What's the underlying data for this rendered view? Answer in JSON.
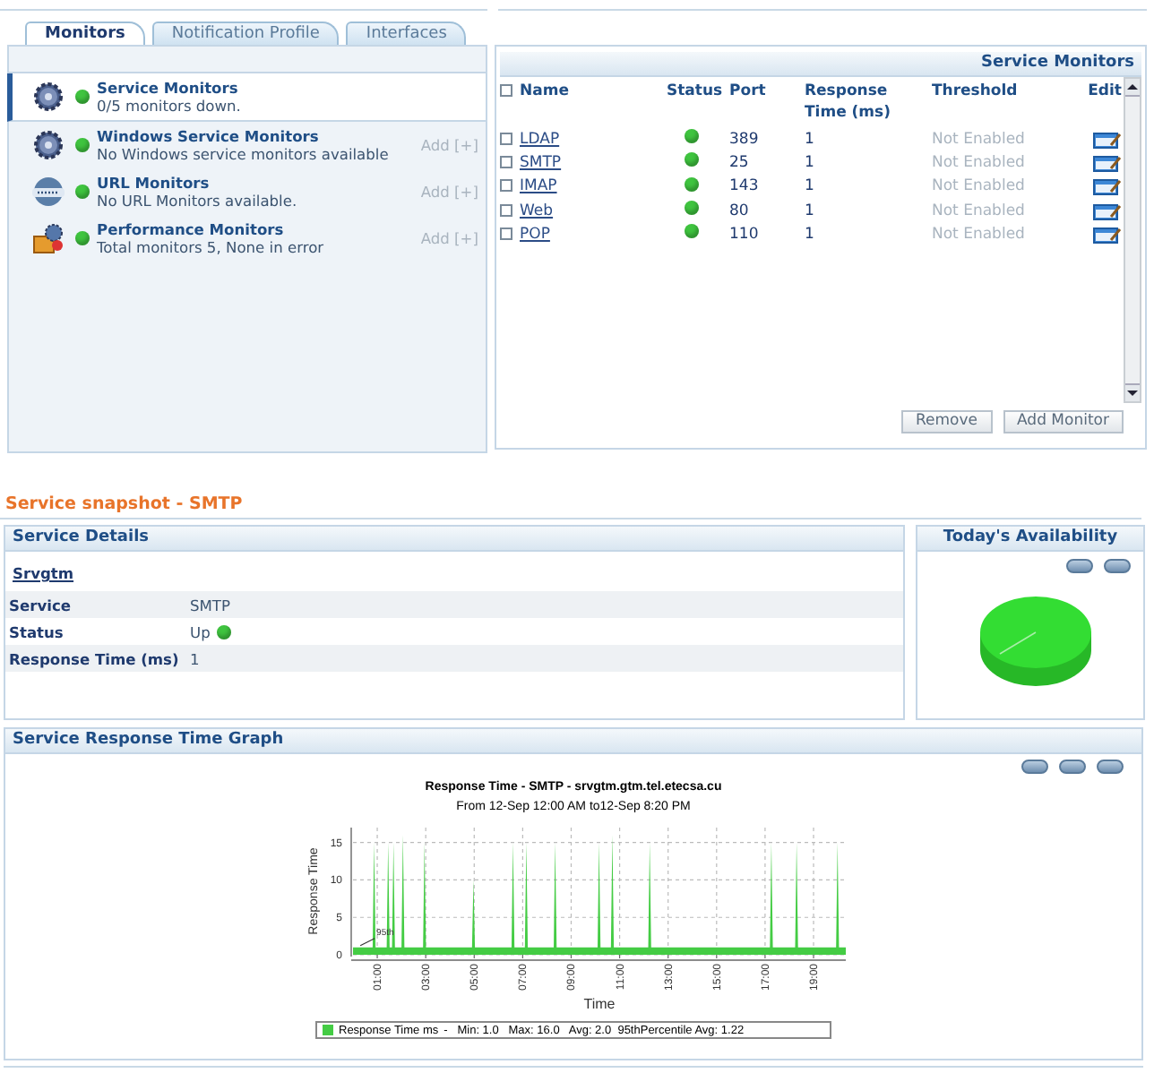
{
  "tabs": [
    {
      "label": "Monitors",
      "selected": true
    },
    {
      "label": "Notification Profile",
      "selected": false
    },
    {
      "label": "Interfaces",
      "selected": false
    }
  ],
  "monitor_groups": [
    {
      "kind": "gear",
      "title": "Service Monitors",
      "subtitle": "0/5 monitors down.",
      "up": true,
      "selected": true
    },
    {
      "kind": "gear",
      "title": "Windows Service Monitors",
      "subtitle": "No Windows service monitors available",
      "up": true,
      "selected": false,
      "add_link": "Add [+]"
    },
    {
      "kind": "globe",
      "title": "URL Monitors",
      "subtitle": "No URL Monitors available.",
      "up": true,
      "selected": false,
      "add_link": "Add [+]"
    },
    {
      "kind": "package",
      "title": "Performance Monitors",
      "subtitle": "Total monitors 5, None in error",
      "up": true,
      "selected": false,
      "add_link": "Add [+]"
    }
  ],
  "service_monitors": {
    "title": "Service Monitors",
    "select_all_checked": false,
    "columns": [
      "Name",
      "Status",
      "Port",
      "Response Time (ms)",
      "Threshold",
      "Edit"
    ],
    "rows": [
      {
        "name": "LDAP",
        "up": true,
        "port": "389",
        "response_time": "1",
        "threshold": "Not Enabled",
        "checked": false
      },
      {
        "name": "SMTP",
        "up": true,
        "port": "25",
        "response_time": "1",
        "threshold": "Not Enabled",
        "checked": false
      },
      {
        "name": "IMAP",
        "up": true,
        "port": "143",
        "response_time": "1",
        "threshold": "Not Enabled",
        "checked": false
      },
      {
        "name": "Web",
        "up": true,
        "port": "80",
        "response_time": "1",
        "threshold": "Not Enabled",
        "checked": false
      },
      {
        "name": "POP",
        "up": true,
        "port": "110",
        "response_time": "1",
        "threshold": "Not Enabled",
        "checked": false
      }
    ],
    "buttons": [
      "Remove",
      "Add Monitor"
    ]
  },
  "snapshot": {
    "title": "Service snapshot - SMTP",
    "details": {
      "title": "Service Details",
      "host": "Srvgtm",
      "rows": [
        {
          "label": "Service",
          "value": "SMTP"
        },
        {
          "label": "Status",
          "value": "Up",
          "up": true
        },
        {
          "label": "Response Time (ms)",
          "value": "1"
        }
      ]
    },
    "availability": {
      "title": "Today's Availability"
    }
  },
  "graph": {
    "title": "Service Response Time Graph",
    "subtitle": "From 12-Sep 12:00 AM to12-Sep 8:20 PM",
    "legend_stats": "-   Min: 1.0   Max: 16.0   Avg: 2.0  95thPercentile Avg: 1.22",
    "chart_data": {
      "type": "area",
      "title": "Response Time - SMTP  - srvgtm.gtm.tel.etecsa.cu",
      "xlabel": "Time",
      "ylabel": "Response Time",
      "x": [
        0,
        0.81,
        0.87,
        0.93,
        1.39,
        1.45,
        1.51,
        1.61,
        1.67,
        1.73,
        2.0,
        2.06,
        2.12,
        2.89,
        2.95,
        3.01,
        4.91,
        4.97,
        5.03,
        6.54,
        6.6,
        6.66,
        7.09,
        7.15,
        7.21,
        8.28,
        8.34,
        8.4,
        10.09,
        10.15,
        10.21,
        10.64,
        10.7,
        10.76,
        12.18,
        12.24,
        12.3,
        17.2,
        17.26,
        17.32,
        18.24,
        18.3,
        18.36,
        19.93,
        19.99,
        20.05,
        20.33
      ],
      "series": [
        {
          "name": "Response Time ms",
          "color": "#44cc44",
          "values": [
            1,
            1,
            15,
            1,
            1,
            15,
            1,
            1,
            15,
            1,
            1,
            16,
            1,
            1,
            15,
            1,
            1,
            10,
            1,
            1,
            15,
            1,
            1,
            15,
            1,
            1,
            15,
            1,
            1,
            15,
            1,
            1,
            16,
            1,
            1,
            15,
            1,
            1,
            15,
            1,
            1,
            15,
            1,
            1,
            15,
            1,
            1
          ]
        }
      ],
      "xlim": [
        0,
        20.33
      ],
      "ylim": [
        0,
        17
      ],
      "grid": true,
      "xticks": [
        {
          "value": 1,
          "label": "01:00"
        },
        {
          "value": 3,
          "label": "03:00"
        },
        {
          "value": 5,
          "label": "05:00"
        },
        {
          "value": 7,
          "label": "07:00"
        },
        {
          "value": 9,
          "label": "09:00"
        },
        {
          "value": 11,
          "label": "11:00"
        },
        {
          "value": 13,
          "label": "13:00"
        },
        {
          "value": 15,
          "label": "15:00"
        },
        {
          "value": 17,
          "label": "17:00"
        },
        {
          "value": 19,
          "label": "19:00"
        }
      ],
      "yticks": [
        0,
        5,
        10,
        15
      ],
      "annotations": [
        {
          "text": "95th",
          "x": 0.3,
          "y": 1.22
        }
      ]
    }
  }
}
